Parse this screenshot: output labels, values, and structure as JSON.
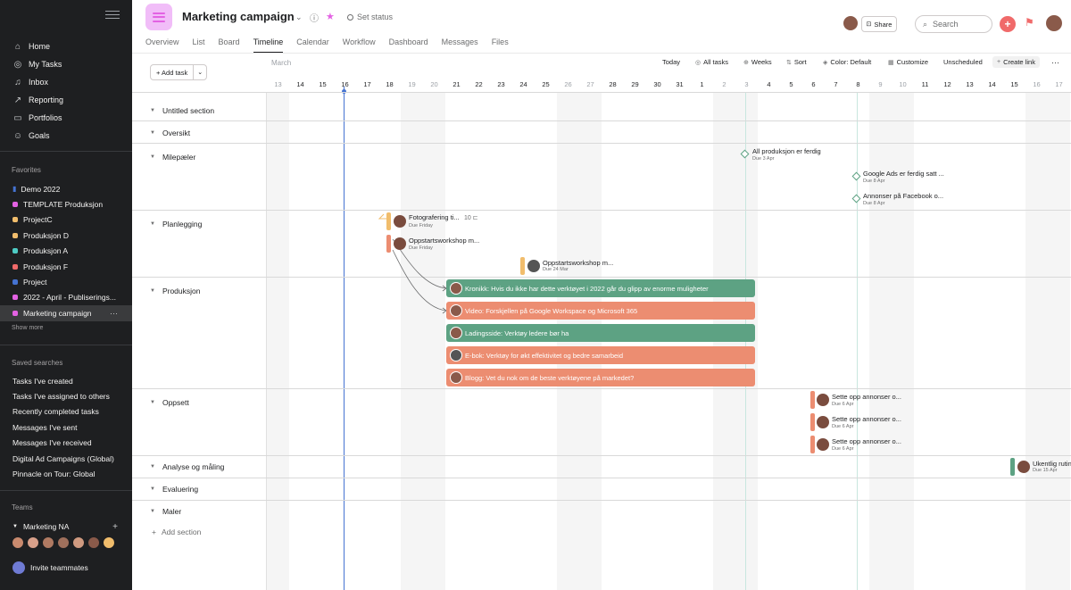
{
  "sidebar": {
    "nav": [
      {
        "label": "Home",
        "icon": "home-icon"
      },
      {
        "label": "My Tasks",
        "icon": "check-circle-icon"
      },
      {
        "label": "Inbox",
        "icon": "bell-icon"
      },
      {
        "label": "Reporting",
        "icon": "chart-line-icon"
      },
      {
        "label": "Portfolios",
        "icon": "portfolio-icon"
      },
      {
        "label": "Goals",
        "icon": "person-icon"
      }
    ],
    "favorites_heading": "Favorites",
    "favorites": [
      {
        "label": "Demo 2022",
        "color": "#4573d2",
        "icon": "bar-chart-icon"
      },
      {
        "label": "TEMPLATE Produksjon",
        "color": "#e362e3"
      },
      {
        "label": "ProjectC",
        "color": "#f1bd6c"
      },
      {
        "label": "Produksjon D",
        "color": "#f1bd6c"
      },
      {
        "label": "Produksjon A",
        "color": "#4ecbc4"
      },
      {
        "label": "Produksjon F",
        "color": "#f06a6a"
      },
      {
        "label": "Project",
        "color": "#4573d2"
      },
      {
        "label": "2022 - April - Publiserings...",
        "color": "#e362e3"
      },
      {
        "label": "Marketing campaign",
        "color": "#e362e3",
        "active": true,
        "more": "···"
      }
    ],
    "show_more": "Show more",
    "saved_heading": "Saved searches",
    "saved": [
      "Tasks I've created",
      "Tasks I've assigned to others",
      "Recently completed tasks",
      "Messages I've sent",
      "Messages I've received",
      "Digital Ad Campaigns (Global)",
      "Pinnacle on Tour: Global"
    ],
    "teams_heading": "Teams",
    "team": "Marketing NA",
    "team_plus": "+",
    "invite": "Invite teammates"
  },
  "header": {
    "title": "Marketing campaign",
    "set_status": "Set status",
    "share": "Share",
    "search_placeholder": "Search",
    "tabs": [
      "Overview",
      "List",
      "Board",
      "Timeline",
      "Calendar",
      "Workflow",
      "Dashboard",
      "Messages",
      "Files"
    ],
    "active_tab": "Timeline"
  },
  "toolbar": {
    "add_task": "+ Add task",
    "today": "Today",
    "all_tasks": "All tasks",
    "weeks": "Weeks",
    "sort": "Sort",
    "color": "Color: Default",
    "customize": "Customize",
    "unscheduled": "Unscheduled",
    "create_link": "Create link",
    "more": "···"
  },
  "timeline": {
    "month": "March",
    "dates": [
      "13",
      "14",
      "15",
      "16",
      "17",
      "18",
      "19",
      "20",
      "21",
      "22",
      "23",
      "24",
      "25",
      "26",
      "27",
      "28",
      "29",
      "30",
      "31",
      "1",
      "2",
      "3",
      "4",
      "5",
      "6",
      "7",
      "8",
      "9",
      "10",
      "11",
      "12",
      "13",
      "14",
      "15",
      "16",
      "17"
    ],
    "weekend_indices": [
      0,
      6,
      7,
      13,
      14,
      20,
      21,
      27,
      28,
      34,
      35
    ],
    "today_index": 3,
    "sections": [
      "Untitled section",
      "Oversikt",
      "Milepæler",
      "Planlegging",
      "Produksjon",
      "Oppsett",
      "Analyse og måling",
      "Evaluering",
      "Maler"
    ],
    "add_section": "Add section"
  },
  "tasks": {
    "milestones": [
      {
        "label": "All produksjon er ferdig",
        "due": "Due 3 Apr"
      },
      {
        "label": "Google Ads er ferdig satt ...",
        "due": "Due 8 Apr"
      },
      {
        "label": "Annonser på Facebook o...",
        "due": "Due 8 Apr"
      }
    ],
    "planning": [
      {
        "label": "Fotografering ti...",
        "due": "Due Friday",
        "subtasks": "10",
        "color": "yellow"
      },
      {
        "label": "Oppstartsworkshop m...",
        "due": "Due Friday",
        "color": "orange"
      },
      {
        "label": "Oppstartsworkshop m...",
        "due": "Due 24 Mar",
        "color": "yellow"
      }
    ],
    "production": [
      {
        "label": "Kronikk: Hvis du ikke har dette verktøyet i 2022 går du glipp av enorme muligheter",
        "color": "green"
      },
      {
        "label": "Video: Forskjellen på Google Workspace og Microsoft 365",
        "color": "orange"
      },
      {
        "label": "Ladingsside: Verktøy ledere bør ha",
        "color": "green"
      },
      {
        "label": "E-bok: Verktøy for økt effektivitet og bedre samarbeid",
        "color": "orange"
      },
      {
        "label": "Blogg: Vet du nok om de beste verktøyene på markedet?",
        "color": "orange"
      }
    ],
    "setup": [
      {
        "label": "Sette opp annonser o...",
        "due": "Due 6 Apr"
      },
      {
        "label": "Sette opp annonser o...",
        "due": "Due 6 Apr"
      },
      {
        "label": "Sette opp annonser o...",
        "due": "Due 6 Apr"
      }
    ],
    "analysis": [
      {
        "label": "Ukentlig rutin",
        "due": "Due 15 Apr"
      }
    ]
  }
}
